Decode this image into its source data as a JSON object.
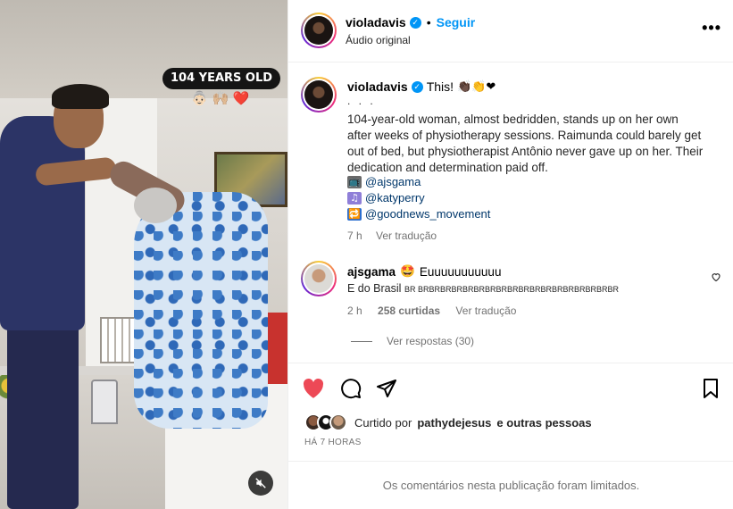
{
  "video": {
    "overlay_label": "104 YEARS OLD",
    "overlay_emojis": "👵🏻 🙌🏼 ❤️"
  },
  "header": {
    "username": "violadavis",
    "separator": "•",
    "follow_label": "Seguir",
    "audio_label": "Áudio original",
    "more_label": "•••"
  },
  "caption": {
    "username": "violadavis",
    "text": "This!",
    "emojis": "👏🏿👏❤",
    "dots": ". . .",
    "body": "104-year-old woman, almost bedridden, stands up on her own after weeks of physiotherapy sessions. Raimunda could barely get out of bed, but physiotherapist Antônio never gave up on her. Their dedication and determination paid off.",
    "tags": [
      {
        "icon": "tv-icon",
        "glyph": "📺",
        "text": "@ajsgama"
      },
      {
        "icon": "music-note-icon",
        "glyph": "♫",
        "text": "@katyperry"
      },
      {
        "icon": "repeat-icon",
        "glyph": "🔁",
        "text": "@goodnews_movement"
      }
    ],
    "time": "7 h",
    "translate": "Ver tradução"
  },
  "comment": {
    "username": "ajsgama",
    "emoji": "🤩",
    "text": "Euuuuuuuuuuu",
    "line2_main": "E do Brasil",
    "line2_small": "BR BRBRBRBRBRBRBRBRBRBRBRBRBRBRBRBRBRBR",
    "time": "2 h",
    "likes": "258 curtidas",
    "translate": "Ver tradução",
    "replies": "Ver respostas (30)"
  },
  "actions": {
    "liked_prefix": "Curtido por",
    "liked_user": "pathydejesus",
    "liked_suffix": "e outras pessoas",
    "time_ago": "HÁ 7 HORAS"
  },
  "footer": {
    "limited": "Os comentários nesta publicação foram limitados."
  },
  "colors": {
    "accent": "#0095f6",
    "like": "#ed4956",
    "link": "#00376b",
    "muted": "#737373"
  }
}
